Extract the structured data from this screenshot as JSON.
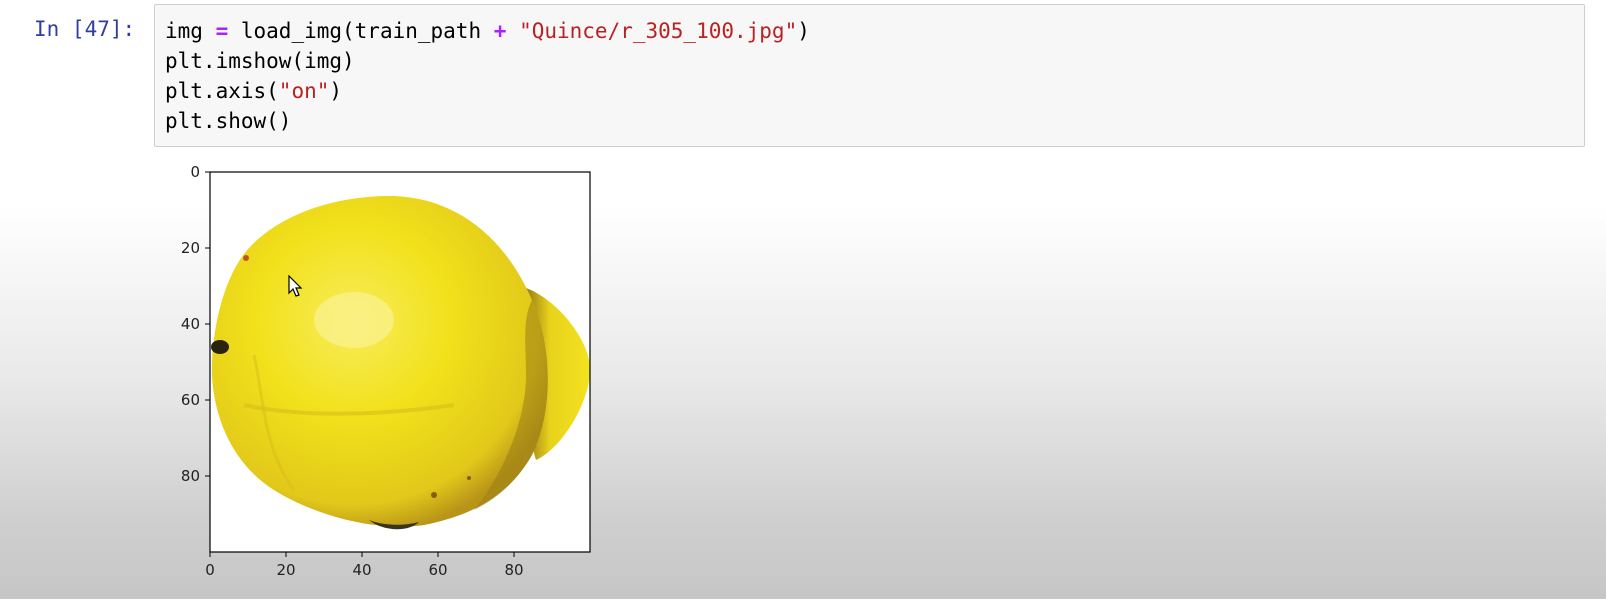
{
  "cell": {
    "prompt": "In [47]:",
    "code_lines": [
      [
        {
          "t": "img ",
          "c": ""
        },
        {
          "t": "=",
          "c": "kw"
        },
        {
          "t": " load_img(train_path ",
          "c": ""
        },
        {
          "t": "+",
          "c": "kw"
        },
        {
          "t": " ",
          "c": ""
        },
        {
          "t": "\"Quince/r_305_100.jpg\"",
          "c": "str"
        },
        {
          "t": ")",
          "c": ""
        }
      ],
      [
        {
          "t": "plt.imshow(img)",
          "c": ""
        }
      ],
      [
        {
          "t": "plt.axis(",
          "c": ""
        },
        {
          "t": "\"on\"",
          "c": "str"
        },
        {
          "t": ")",
          "c": ""
        }
      ],
      [
        {
          "t": "plt.show()",
          "c": ""
        }
      ]
    ]
  },
  "colors": {
    "prompt": "#303f9f",
    "operator": "#aa22ff",
    "string": "#ba2121",
    "cell_bg": "#f7f7f7",
    "cell_border": "#cfcfcf",
    "quince_yellow": "#f1e11b",
    "quince_shadow": "#c8a41a"
  },
  "output": {
    "plot_content": "quince-fruit-image",
    "axis": "on",
    "x_ticks": [
      "0",
      "20",
      "40",
      "60",
      "80"
    ],
    "y_ticks": [
      "0",
      "20",
      "40",
      "60",
      "80"
    ],
    "xlim": [
      0,
      100
    ],
    "ylim": [
      0,
      100
    ]
  }
}
